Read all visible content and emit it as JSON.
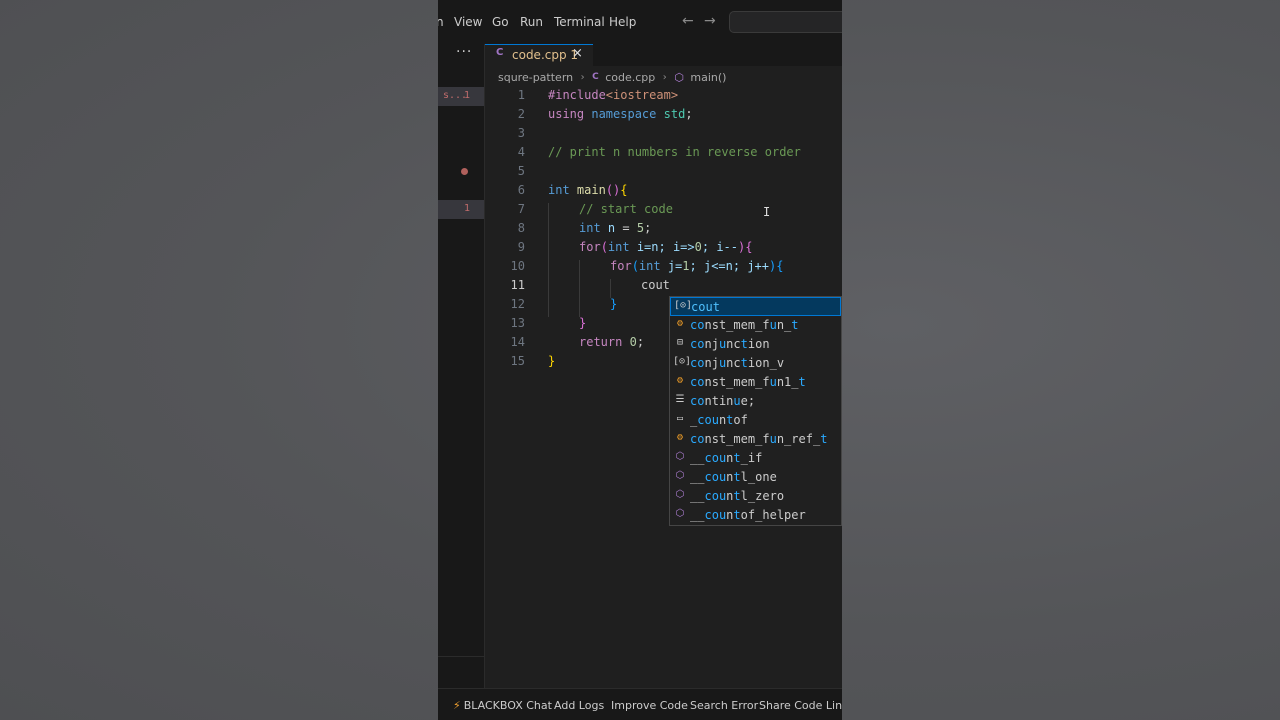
{
  "menu": {
    "items": [
      "n",
      "View",
      "Go",
      "Run",
      "Terminal",
      "Help"
    ],
    "back_icon": "arrow-left-icon",
    "forward_icon": "arrow-right-icon"
  },
  "sidebar": {
    "more_label": "···",
    "problem_rows": [
      {
        "label": "s...",
        "count": "1"
      },
      {
        "label": "",
        "count": "1"
      }
    ]
  },
  "tab": {
    "icon": "C",
    "name": "code.cpp 1",
    "close": "×"
  },
  "breadcrumb": {
    "folder": "squre-pattern",
    "file_icon": "C",
    "file": "code.cpp",
    "symbol_icon": "⬡",
    "symbol": "main()"
  },
  "editor": {
    "line_numbers": [
      "1",
      "2",
      "3",
      "4",
      "5",
      "6",
      "7",
      "8",
      "9",
      "10",
      "11",
      "12",
      "13",
      "14",
      "15"
    ],
    "active_line": "11",
    "lines": {
      "l1_pp": "#include",
      "l1_lib": "<iostream>",
      "l2_using": "using",
      "l2_ns": "namespace",
      "l2_std": "std",
      "l2_semi": ";",
      "l4_comment": "// print n numbers in reverse order",
      "l6_int": "int",
      "l6_fn": "main",
      "l6_paren": "()",
      "l6_brace": "{",
      "l7_comment": "// start code",
      "l8_int": "int",
      "l8_var": "n",
      "l8_eq": " = ",
      "l8_num": "5",
      "l8_semi": ";",
      "l9_for": "for",
      "l9_open": "(",
      "l9_int": "int",
      "l9_body": " i=n; i=>",
      "l9_zero": "0",
      "l9_rest": "; i--",
      "l9_close": ")",
      "l9_brace": "{",
      "l10_for": "for",
      "l10_open": "(",
      "l10_int": "int",
      "l10_body": " j=",
      "l10_one": "1",
      "l10_rest": "; j<=n; j++",
      "l10_close": ")",
      "l10_brace": "{",
      "l11_text": "cout",
      "l12_brace": "}",
      "l13_brace": "}",
      "l14_return": "return",
      "l14_zero": "0",
      "l14_semi": ";",
      "l15_brace": "}"
    }
  },
  "suggestions": [
    {
      "icon": "variable-icon",
      "glyph": "[⊙]",
      "match": "co",
      "rest": "ut",
      "full_match": true,
      "selected": true
    },
    {
      "icon": "class-icon",
      "glyph": "⚙",
      "label": "const_mem_fun_t"
    },
    {
      "icon": "struct-icon",
      "glyph": "⊟",
      "label": "conjunction"
    },
    {
      "icon": "variable-icon",
      "glyph": "[⊙]",
      "label": "conjunction_v"
    },
    {
      "icon": "class-icon",
      "glyph": "⚙",
      "label": "const_mem_fun1_t"
    },
    {
      "icon": "snippet-icon",
      "glyph": "☰",
      "label": "continue;"
    },
    {
      "icon": "text-icon",
      "glyph": "▭",
      "label": "_countof"
    },
    {
      "icon": "class-icon",
      "glyph": "⚙",
      "label": "const_mem_fun_ref_t"
    },
    {
      "icon": "method-icon",
      "glyph": "⬡",
      "label": "__count_if"
    },
    {
      "icon": "method-icon",
      "glyph": "⬡",
      "label": "__countl_one"
    },
    {
      "icon": "method-icon",
      "glyph": "⬡",
      "label": "__countl_zero"
    },
    {
      "icon": "method-icon",
      "glyph": "⬡",
      "label": "__countof_helper"
    }
  ],
  "statusbar": {
    "bolt_icon": "⚡",
    "items": [
      "BLACKBOX Chat",
      "Add Logs",
      "Improve Code",
      "Search Error",
      "Share Code Link"
    ]
  }
}
